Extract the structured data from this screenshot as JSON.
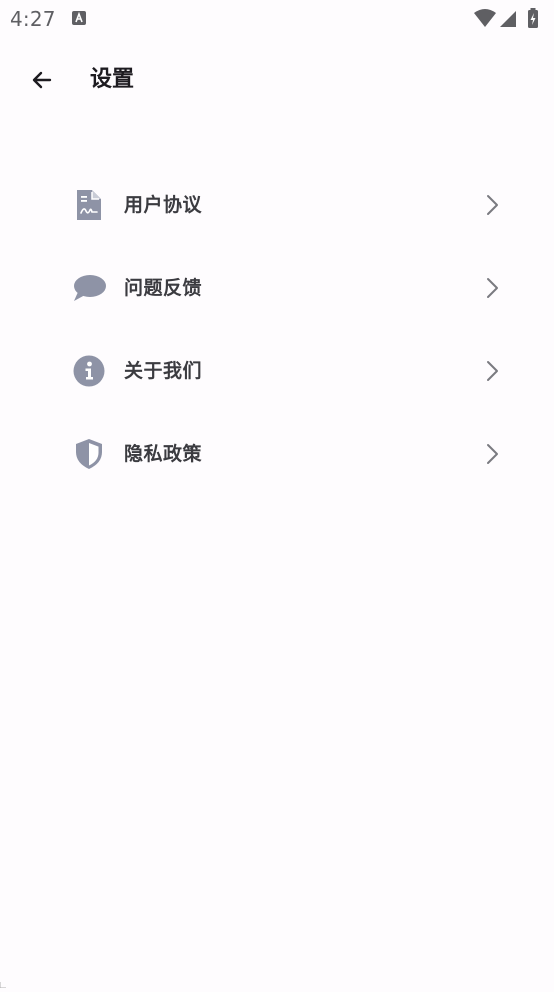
{
  "status_bar": {
    "time": "4:27",
    "notification_icon": "a-notification-icon",
    "icons": [
      "wifi-icon",
      "signal-icon",
      "battery-charging-icon"
    ]
  },
  "app_bar": {
    "back_icon": "arrow-back-icon",
    "title": "设置"
  },
  "menu": {
    "items": [
      {
        "label": "用户协议",
        "icon": "document-signature-icon"
      },
      {
        "label": "问题反馈",
        "icon": "chat-bubble-icon"
      },
      {
        "label": "关于我们",
        "icon": "info-icon"
      },
      {
        "label": "隐私政策",
        "icon": "shield-icon"
      }
    ],
    "trailing_icon": "chevron-right-icon"
  },
  "colors": {
    "background": "#fefcfe",
    "icon_gray": "#8e93a6",
    "label": "#3b3b40",
    "chevron": "#7a7a80",
    "status_gray": "#5f5f63"
  }
}
